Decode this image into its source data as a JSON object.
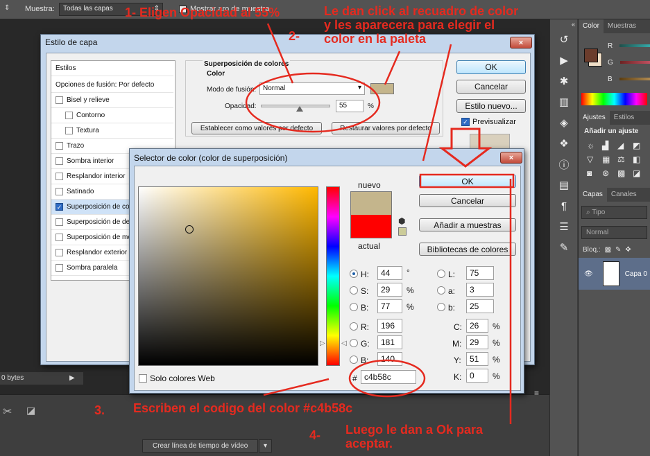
{
  "photoshop": {
    "options_bar": {
      "sample_label": "Muestra:",
      "sample_value": "Todas las capas",
      "sample_ring_label": "Mostrar aro de muestra"
    },
    "status_text": "0 bytes",
    "timeline_button": "Crear línea de tiempo de vídeo",
    "right_panel": {
      "tab_color": "Color",
      "tab_swatches": "Muestras",
      "channel_r": "R",
      "channel_g": "G",
      "channel_b": "B",
      "tab_adjustments": "Ajustes",
      "tab_styles": "Estilos",
      "add_adjustment": "Añadir un ajuste",
      "tab_layers": "Capas",
      "tab_channels": "Canales",
      "kind_placeholder": "Tipo",
      "blend_mode": "Normal",
      "lock_label": "Bloq.:",
      "layer_name": "Capa 0"
    }
  },
  "layer_style": {
    "title": "Estilo de capa",
    "close": "×",
    "styles_header": "Estilos",
    "blend_options": "Opciones de fusión: Por defecto",
    "items": [
      {
        "label": "Bisel y relieve",
        "checked": false,
        "indent": false
      },
      {
        "label": "Contorno",
        "checked": false,
        "indent": true
      },
      {
        "label": "Textura",
        "checked": false,
        "indent": true
      },
      {
        "label": "Trazo",
        "checked": false,
        "indent": false
      },
      {
        "label": "Sombra interior",
        "checked": false,
        "indent": false
      },
      {
        "label": "Resplandor interior",
        "checked": false,
        "indent": false
      },
      {
        "label": "Satinado",
        "checked": false,
        "indent": false
      },
      {
        "label": "Superposición de colo",
        "checked": true,
        "indent": false
      },
      {
        "label": "Superposición de de",
        "checked": false,
        "indent": false
      },
      {
        "label": "Superposición de mo",
        "checked": false,
        "indent": false
      },
      {
        "label": "Resplandor exterior",
        "checked": false,
        "indent": false
      },
      {
        "label": "Sombra paralela",
        "checked": false,
        "indent": false
      }
    ],
    "section_title": "Superposición de colores",
    "group_title": "Color",
    "blend_mode_label": "Modo de fusión:",
    "blend_mode_value": "Normal",
    "swatch_color": "#c4b58c",
    "opacity_label": "Opacidad:",
    "opacity_value": "55",
    "opacity_unit": "%",
    "opacity_fraction": 0.55,
    "set_default_button": "Establecer como valores por defecto",
    "reset_default_button": "Restaurar valores por defecto",
    "ok_button": "OK",
    "cancel_button": "Cancelar",
    "new_style_button": "Estilo nuevo...",
    "preview_label": "Previsualizar",
    "preview_checked": true
  },
  "color_picker": {
    "title": "Selector de color (color de superposición)",
    "close": "×",
    "new_label": "nuevo",
    "current_label": "actual",
    "new_color": "#c4b58c",
    "current_color": "#ff0000",
    "ok_button": "OK",
    "cancel_button": "Cancelar",
    "add_swatches_button": "Añadir a muestras",
    "libraries_button": "Bibliotecas de colores",
    "h_label": "H:",
    "h_value": "44",
    "h_unit": "°",
    "s_label": "S:",
    "s_value": "29",
    "s_unit": "%",
    "b_label": "B:",
    "b_value": "77",
    "b_unit": "%",
    "r_label": "R:",
    "r_value": "196",
    "g_label": "G:",
    "g_value": "181",
    "bb_label": "B:",
    "bb_value": "140",
    "l_label": "L:",
    "l_value": "75",
    "a_label": "a:",
    "a_value": "3",
    "lab_b_label": "b:",
    "lab_b_value": "25",
    "c_label": "C:",
    "c_value": "26",
    "c_unit": "%",
    "m_label": "M:",
    "m_value": "29",
    "m_unit": "%",
    "y_label": "Y:",
    "y_value": "51",
    "y_unit": "%",
    "k_label": "K:",
    "k_value": "0",
    "k_unit": "%",
    "hex_label": "#",
    "hex_value": "c4b58c",
    "web_only_label": "Solo colores Web"
  },
  "annotations": {
    "step1": "1-  Eligen Opacidad al 55%",
    "step2_num": "2-",
    "step2_text": "Le dan click al recuadro de color\ny les aparecera para elegir el\ncolor en la paleta",
    "step3_num": "3.",
    "step3_text": "Escriben el codigo del color  #c4b58c",
    "step4_num": "4-",
    "step4_text": "Luego le dan a Ok para\naceptar.",
    "color": "#e52a1f"
  }
}
